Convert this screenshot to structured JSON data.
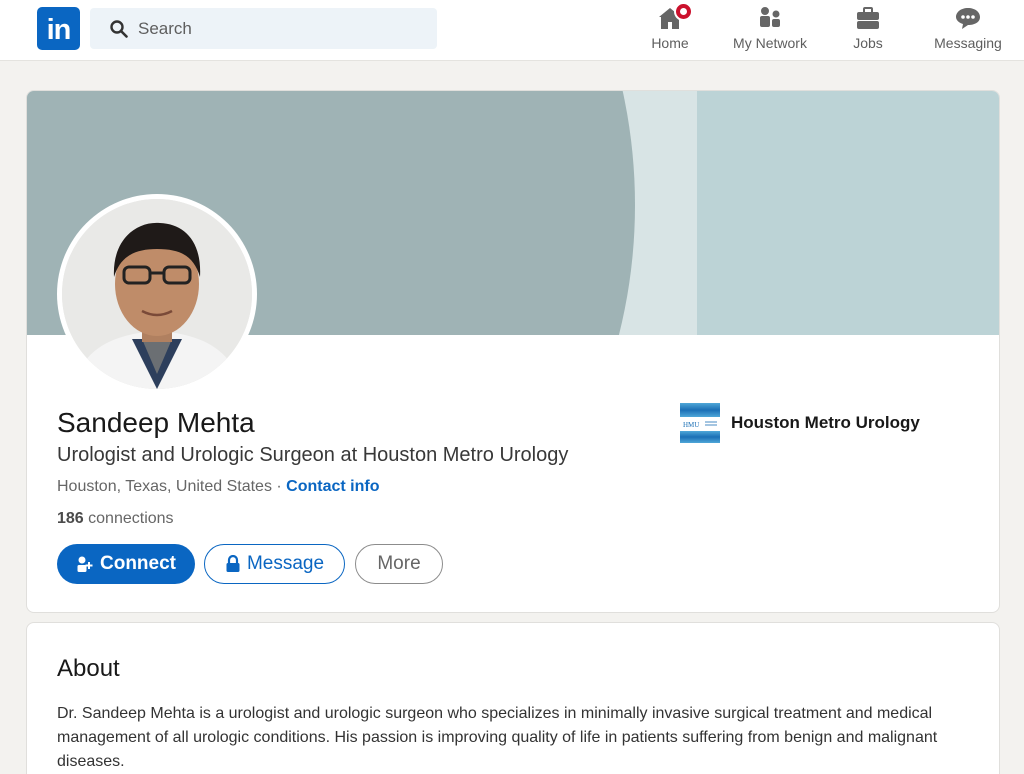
{
  "nav": {
    "search_placeholder": "Search",
    "items": [
      {
        "label": "Home",
        "icon": "home-icon"
      },
      {
        "label": "My Network",
        "icon": "network-icon"
      },
      {
        "label": "Jobs",
        "icon": "briefcase-icon"
      },
      {
        "label": "Messaging",
        "icon": "messaging-icon"
      }
    ],
    "logo": "in"
  },
  "profile": {
    "name": "Sandeep Mehta",
    "headline": "Urologist and Urologic Surgeon at Houston Metro Urology",
    "location": "Houston, Texas, United States",
    "separator": " · ",
    "contact_info_label": "Contact info",
    "connections_count": "186",
    "connections_label": "connections",
    "buttons": {
      "connect": "Connect",
      "message": "Message",
      "more": "More"
    },
    "company": {
      "name": "Houston Metro Urology",
      "logo_text": "HMU"
    }
  },
  "about": {
    "title": "About",
    "text": "Dr. Sandeep Mehta is a urologist and urologic surgeon who specializes in minimally invasive surgical treatment and medical management of all urologic conditions. His passion is improving quality of life in patients suffering from benign and malignant diseases."
  },
  "colors": {
    "brand": "#0a66c2",
    "notification": "#cb112d",
    "banner_dark": "#9fb3b5",
    "banner_light": "#bcd3d6"
  }
}
